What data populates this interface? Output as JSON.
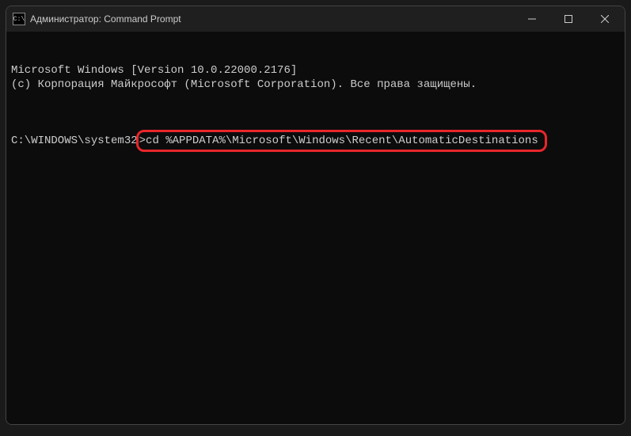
{
  "titlebar": {
    "icon_text": "C:\\",
    "title": "Администратор: Command Prompt"
  },
  "terminal": {
    "line1": "Microsoft Windows [Version 10.0.22000.2176]",
    "line2": "(c) Корпорация Майкрософт (Microsoft Corporation). Все права защищены.",
    "prompt_prefix": "C:\\WINDOWS\\system32",
    "prompt_char": ">",
    "command": "cd %APPDATA%\\Microsoft\\Windows\\Recent\\AutomaticDestinations"
  }
}
